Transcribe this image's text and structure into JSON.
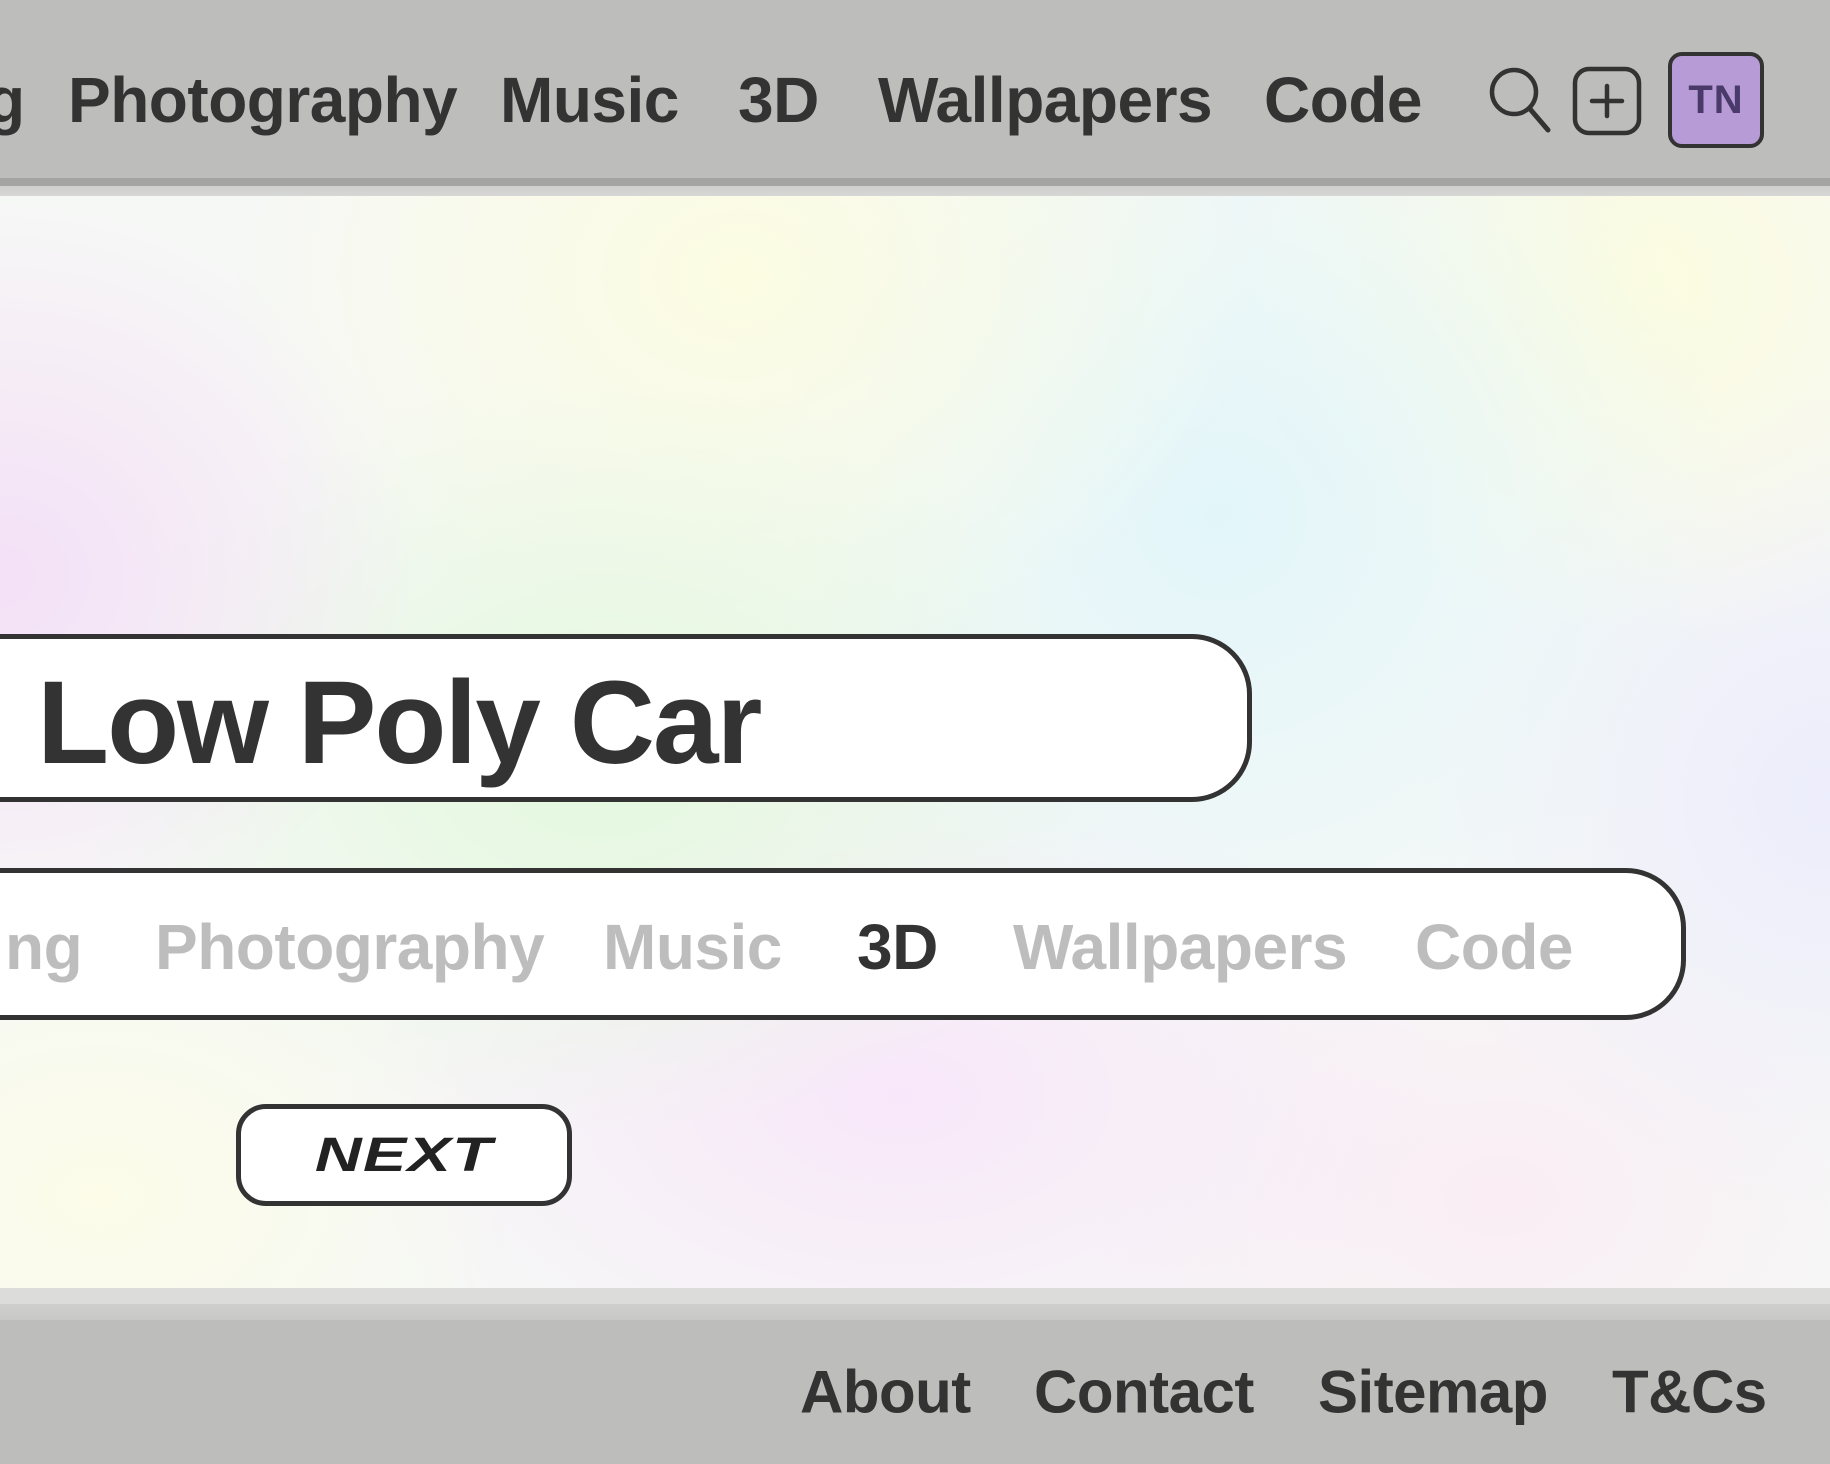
{
  "header": {
    "nav_items": [
      {
        "label": "g"
      },
      {
        "label": "Photography"
      },
      {
        "label": "Music"
      },
      {
        "label": "3D"
      },
      {
        "label": "Wallpapers"
      },
      {
        "label": "Code"
      }
    ],
    "icons": [
      "search-icon",
      "add-icon"
    ],
    "avatar_initials": "TN",
    "avatar_color": "#b79bd6"
  },
  "hero": {
    "title": "Low Poly Car",
    "categories": [
      {
        "label": "ng",
        "active": false
      },
      {
        "label": "Photography",
        "active": false
      },
      {
        "label": "Music",
        "active": false
      },
      {
        "label": "3D",
        "active": true
      },
      {
        "label": "Wallpapers",
        "active": false
      },
      {
        "label": "Code",
        "active": false
      }
    ],
    "next_label": "NEXT"
  },
  "footer": {
    "links": [
      {
        "label": "About"
      },
      {
        "label": "Contact"
      },
      {
        "label": "Sitemap"
      },
      {
        "label": "T&Cs"
      }
    ]
  },
  "colors": {
    "text_dark": "#333333",
    "category_inactive": "#bdbdbd",
    "bar_background": "#bdbdbb"
  }
}
